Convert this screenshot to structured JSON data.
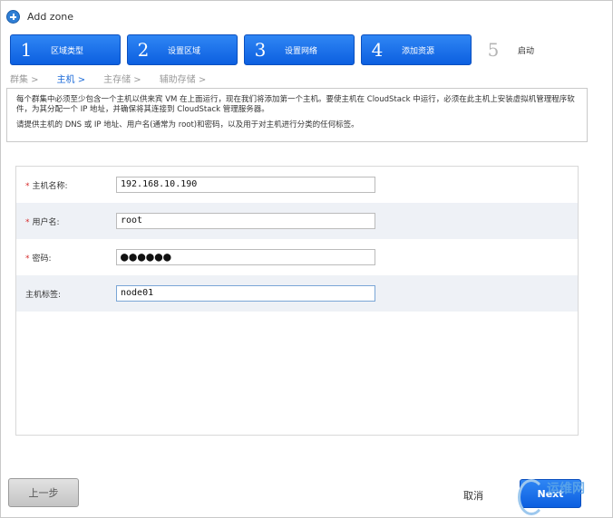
{
  "header": {
    "title": "Add zone"
  },
  "steps": [
    {
      "num": "1",
      "label": "区域类型"
    },
    {
      "num": "2",
      "label": "设置区域"
    },
    {
      "num": "3",
      "label": "设置网络"
    },
    {
      "num": "4",
      "label": "添加资源"
    },
    {
      "num": "5",
      "label": "启动"
    }
  ],
  "subnav": [
    {
      "label": "群集 >"
    },
    {
      "label": "主机 >"
    },
    {
      "label": "主存储 >"
    },
    {
      "label": "辅助存储 >"
    }
  ],
  "info": {
    "line1": "每个群集中必须至少包含一个主机以供来宾 VM 在上面运行，现在我们将添加第一个主机。要使主机在 CloudStack 中运行，必须在此主机上安装虚拟机管理程序软件，为其分配一个 IP 地址，并确保将其连接到 CloudStack 管理服务器。",
    "line2": "请提供主机的 DNS 或 IP 地址、用户名(通常为 root)和密码，以及用于对主机进行分类的任何标签。"
  },
  "form": {
    "hostname": {
      "label": "主机名称:",
      "value": "192.168.10.190"
    },
    "username": {
      "label": "用户名:",
      "value": "root"
    },
    "password": {
      "label": "密码:",
      "value": "●●●●●●"
    },
    "hosttags": {
      "label": "主机标签:",
      "value": "node01"
    }
  },
  "footer": {
    "prev": "上一步",
    "cancel": "取消",
    "next": "Next"
  },
  "watermark": {
    "text": "运维网"
  },
  "colors": {
    "accent": "#1b6ad8",
    "step_bg": "#0c5fe0",
    "required": "#d62b2b"
  }
}
